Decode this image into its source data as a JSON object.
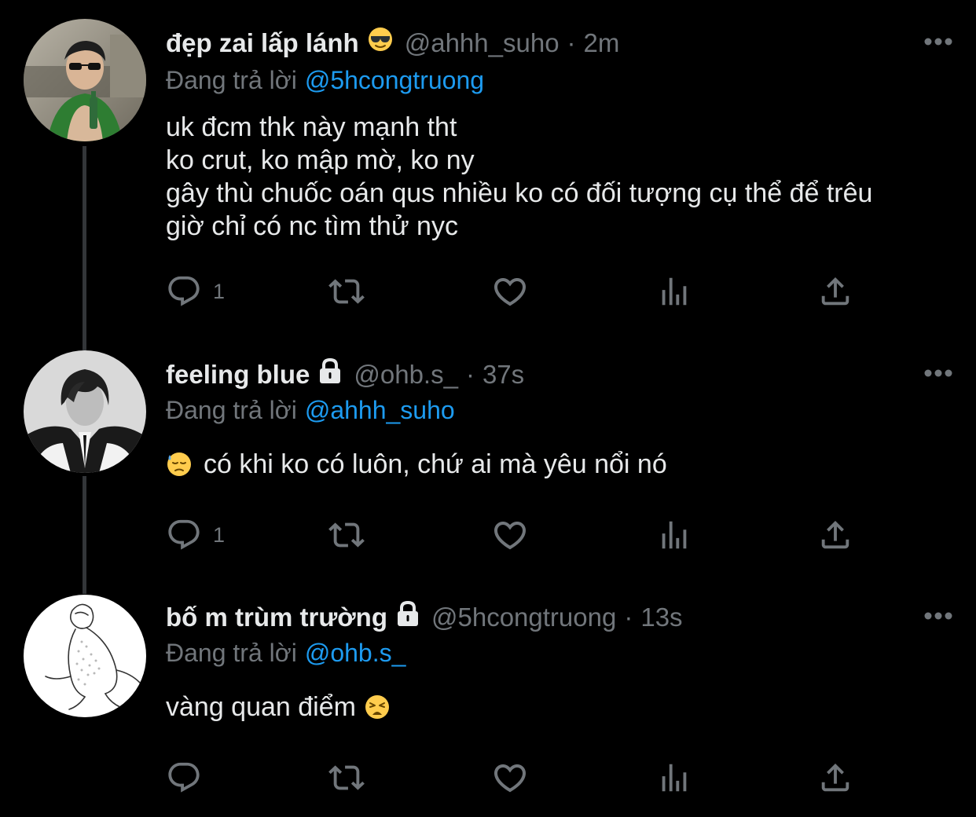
{
  "colors": {
    "background": "#000000",
    "primary_text": "#e7e9ea",
    "secondary_text": "#71767b",
    "link": "#1d9bf0",
    "thread_line": "#333639"
  },
  "icons": {
    "reply": "speech-bubble-icon",
    "retweet": "retweet-icon",
    "like": "heart-icon",
    "views": "bar-chart-icon",
    "share": "share-upload-icon",
    "more": "more-dots-icon",
    "lock": "lock-icon"
  },
  "tweets": [
    {
      "display_name": "đẹp zai lấp lánh",
      "name_emoji": "sunglasses-emoji",
      "handle": "@ahhh_suho",
      "separator": "·",
      "time": "2m",
      "reply_prefix": "Đang trả lời",
      "reply_to": "@5hcongtruong",
      "lines": [
        "uk đcm thk này mạnh tht",
        "ko crut, ko mập mờ, ko ny",
        "gây thù chuốc oán qus nhiều ko có đối tượng cụ thể để trêu",
        "giờ chỉ có nc tìm thử nyc"
      ],
      "reply_count": "1"
    },
    {
      "display_name": "feeling blue",
      "locked": true,
      "handle": "@ohb.s_",
      "separator": "·",
      "time": "37s",
      "reply_prefix": "Đang trả lời",
      "reply_to": "@ahhh_suho",
      "leading_emoji": "downcast-face-with-sweat-emoji",
      "text": "có khi ko có luôn, chứ ai mà yêu nổi nó",
      "reply_count": "1"
    },
    {
      "display_name": "bố m trùm trường",
      "locked": true,
      "handle": "@5hcongtruong",
      "separator": "·",
      "time": "13s",
      "reply_prefix": "Đang trả lời",
      "reply_to": "@ohb.s_",
      "text": "vàng quan điểm",
      "trailing_emoji": "weary-face-emoji",
      "reply_count": ""
    }
  ]
}
